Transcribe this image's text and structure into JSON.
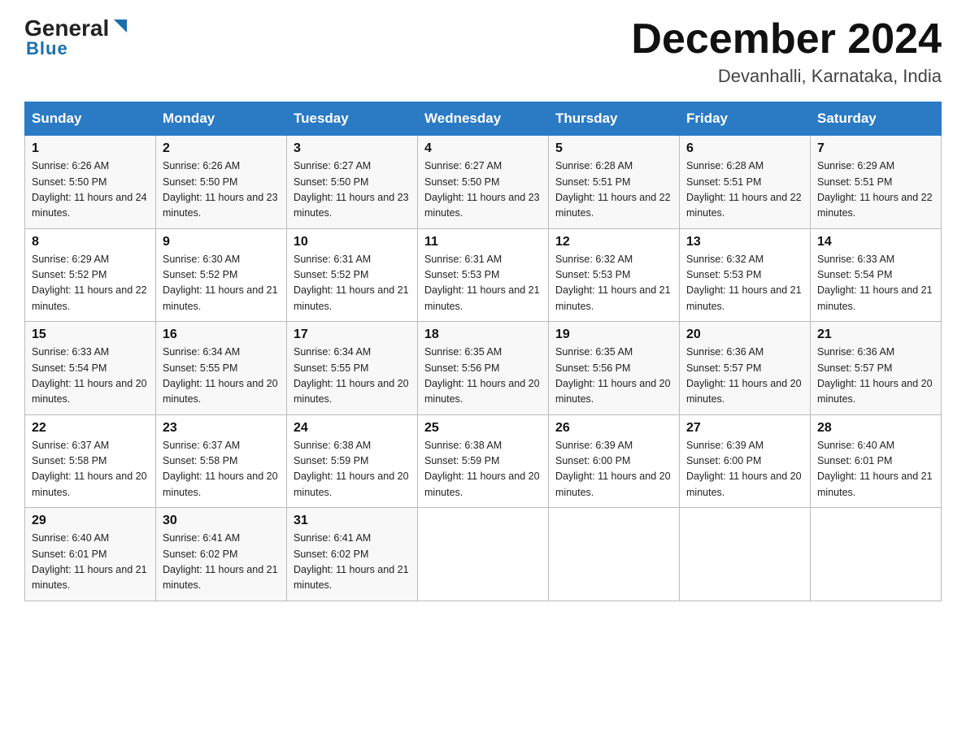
{
  "header": {
    "logo_text1": "General",
    "logo_text2": "Blue",
    "month_title": "December 2024",
    "location": "Devanhalli, Karnataka, India"
  },
  "weekdays": [
    "Sunday",
    "Monday",
    "Tuesday",
    "Wednesday",
    "Thursday",
    "Friday",
    "Saturday"
  ],
  "weeks": [
    [
      {
        "day": "1",
        "sunrise": "6:26 AM",
        "sunset": "5:50 PM",
        "daylight": "11 hours and 24 minutes."
      },
      {
        "day": "2",
        "sunrise": "6:26 AM",
        "sunset": "5:50 PM",
        "daylight": "11 hours and 23 minutes."
      },
      {
        "day": "3",
        "sunrise": "6:27 AM",
        "sunset": "5:50 PM",
        "daylight": "11 hours and 23 minutes."
      },
      {
        "day": "4",
        "sunrise": "6:27 AM",
        "sunset": "5:50 PM",
        "daylight": "11 hours and 23 minutes."
      },
      {
        "day": "5",
        "sunrise": "6:28 AM",
        "sunset": "5:51 PM",
        "daylight": "11 hours and 22 minutes."
      },
      {
        "day": "6",
        "sunrise": "6:28 AM",
        "sunset": "5:51 PM",
        "daylight": "11 hours and 22 minutes."
      },
      {
        "day": "7",
        "sunrise": "6:29 AM",
        "sunset": "5:51 PM",
        "daylight": "11 hours and 22 minutes."
      }
    ],
    [
      {
        "day": "8",
        "sunrise": "6:29 AM",
        "sunset": "5:52 PM",
        "daylight": "11 hours and 22 minutes."
      },
      {
        "day": "9",
        "sunrise": "6:30 AM",
        "sunset": "5:52 PM",
        "daylight": "11 hours and 21 minutes."
      },
      {
        "day": "10",
        "sunrise": "6:31 AM",
        "sunset": "5:52 PM",
        "daylight": "11 hours and 21 minutes."
      },
      {
        "day": "11",
        "sunrise": "6:31 AM",
        "sunset": "5:53 PM",
        "daylight": "11 hours and 21 minutes."
      },
      {
        "day": "12",
        "sunrise": "6:32 AM",
        "sunset": "5:53 PM",
        "daylight": "11 hours and 21 minutes."
      },
      {
        "day": "13",
        "sunrise": "6:32 AM",
        "sunset": "5:53 PM",
        "daylight": "11 hours and 21 minutes."
      },
      {
        "day": "14",
        "sunrise": "6:33 AM",
        "sunset": "5:54 PM",
        "daylight": "11 hours and 21 minutes."
      }
    ],
    [
      {
        "day": "15",
        "sunrise": "6:33 AM",
        "sunset": "5:54 PM",
        "daylight": "11 hours and 20 minutes."
      },
      {
        "day": "16",
        "sunrise": "6:34 AM",
        "sunset": "5:55 PM",
        "daylight": "11 hours and 20 minutes."
      },
      {
        "day": "17",
        "sunrise": "6:34 AM",
        "sunset": "5:55 PM",
        "daylight": "11 hours and 20 minutes."
      },
      {
        "day": "18",
        "sunrise": "6:35 AM",
        "sunset": "5:56 PM",
        "daylight": "11 hours and 20 minutes."
      },
      {
        "day": "19",
        "sunrise": "6:35 AM",
        "sunset": "5:56 PM",
        "daylight": "11 hours and 20 minutes."
      },
      {
        "day": "20",
        "sunrise": "6:36 AM",
        "sunset": "5:57 PM",
        "daylight": "11 hours and 20 minutes."
      },
      {
        "day": "21",
        "sunrise": "6:36 AM",
        "sunset": "5:57 PM",
        "daylight": "11 hours and 20 minutes."
      }
    ],
    [
      {
        "day": "22",
        "sunrise": "6:37 AM",
        "sunset": "5:58 PM",
        "daylight": "11 hours and 20 minutes."
      },
      {
        "day": "23",
        "sunrise": "6:37 AM",
        "sunset": "5:58 PM",
        "daylight": "11 hours and 20 minutes."
      },
      {
        "day": "24",
        "sunrise": "6:38 AM",
        "sunset": "5:59 PM",
        "daylight": "11 hours and 20 minutes."
      },
      {
        "day": "25",
        "sunrise": "6:38 AM",
        "sunset": "5:59 PM",
        "daylight": "11 hours and 20 minutes."
      },
      {
        "day": "26",
        "sunrise": "6:39 AM",
        "sunset": "6:00 PM",
        "daylight": "11 hours and 20 minutes."
      },
      {
        "day": "27",
        "sunrise": "6:39 AM",
        "sunset": "6:00 PM",
        "daylight": "11 hours and 20 minutes."
      },
      {
        "day": "28",
        "sunrise": "6:40 AM",
        "sunset": "6:01 PM",
        "daylight": "11 hours and 21 minutes."
      }
    ],
    [
      {
        "day": "29",
        "sunrise": "6:40 AM",
        "sunset": "6:01 PM",
        "daylight": "11 hours and 21 minutes."
      },
      {
        "day": "30",
        "sunrise": "6:41 AM",
        "sunset": "6:02 PM",
        "daylight": "11 hours and 21 minutes."
      },
      {
        "day": "31",
        "sunrise": "6:41 AM",
        "sunset": "6:02 PM",
        "daylight": "11 hours and 21 minutes."
      },
      null,
      null,
      null,
      null
    ]
  ]
}
